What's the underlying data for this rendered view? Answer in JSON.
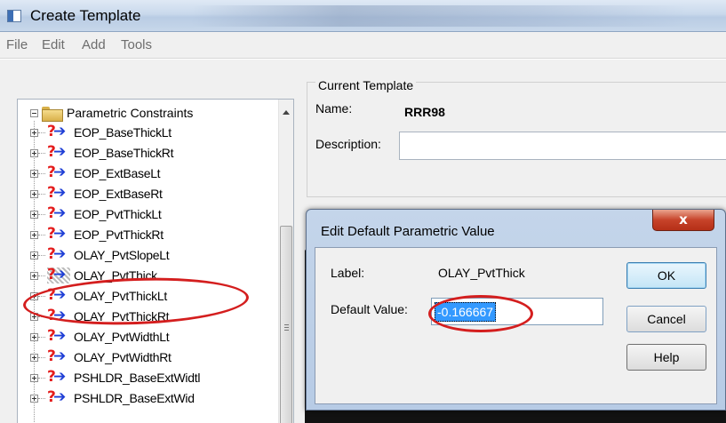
{
  "window": {
    "title": "Create Template"
  },
  "menu": {
    "items": [
      "File",
      "Edit",
      "Add",
      "Tools"
    ]
  },
  "tree": {
    "root_label": "Parametric Constraints",
    "items": [
      "EOP_BaseThickLt",
      "EOP_BaseThickRt",
      "EOP_ExtBaseLt",
      "EOP_ExtBaseRt",
      "EOP_PvtThickLt",
      "EOP_PvtThickRt",
      "OLAY_PvtSlopeLt",
      "OLAY_PvtThick",
      "OLAY_PvtThickLt",
      "OLAY_PvtThickRt",
      "OLAY_PvtWidthLt",
      "OLAY_PvtWidthRt",
      "PSHLDR_BaseExtWidtl",
      "PSHLDR_BaseExtWid"
    ],
    "selected_item": "OLAY_PvtThick"
  },
  "template_panel": {
    "group_title": "Current Template",
    "name_label": "Name:",
    "name_value": "RRR98",
    "description_label": "Description:",
    "description_value": ""
  },
  "dialog": {
    "title": "Edit Default Parametric Value",
    "close_label": "x",
    "label_caption": "Label:",
    "label_value": "OLAY_PvtThick",
    "default_caption": "Default Value:",
    "default_value": "-0.166667",
    "ok_label": "OK",
    "cancel_label": "Cancel",
    "help_label": "Help"
  },
  "colors": {
    "annotation_red": "#d41e1e",
    "selection_blue": "#3399ff",
    "icon_arrow_blue": "#1f3fd6",
    "icon_question_red": "#e41c1c"
  }
}
